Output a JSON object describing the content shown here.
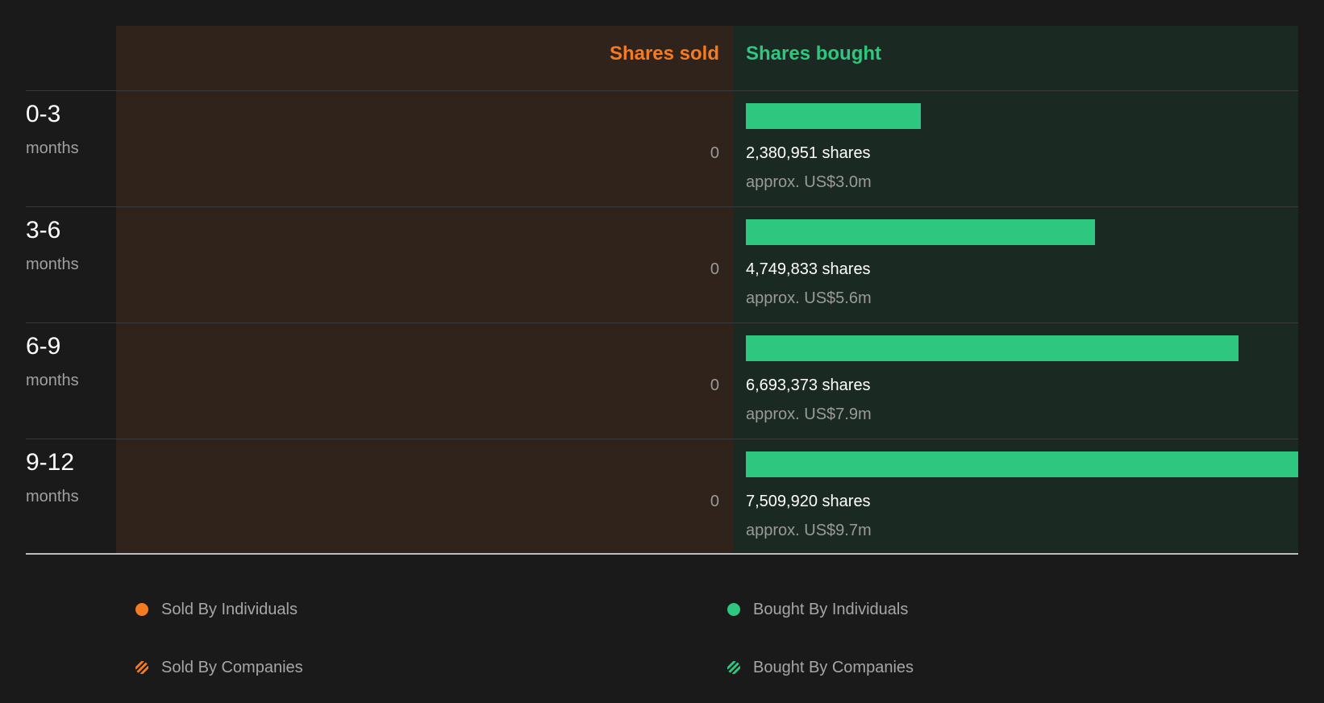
{
  "colors": {
    "sold": "#f47b20",
    "bought": "#2dc77f",
    "sold_panel_bg": "#30231b",
    "bought_panel_bg": "#1b2923",
    "page_bg": "#1a1a1a"
  },
  "chart_data": {
    "type": "bar",
    "title": "",
    "xlabel": "",
    "ylabel": "",
    "headers": {
      "sold": "Shares sold",
      "bought": "Shares bought"
    },
    "categories": [
      "0-3",
      "3-6",
      "6-9",
      "9-12"
    ],
    "unit_label": "months",
    "series": [
      {
        "name": "Shares sold",
        "values": [
          0,
          0,
          0,
          0
        ],
        "labels": [
          "0",
          "0",
          "0",
          "0"
        ]
      },
      {
        "name": "Shares bought",
        "values": [
          2380951,
          4749833,
          6693373,
          7509920
        ],
        "labels": [
          "2,380,951 shares",
          "4,749,833 shares",
          "6,693,373 shares",
          "7,509,920 shares"
        ],
        "approx": [
          "approx. US$3.0m",
          "approx. US$5.6m",
          "approx. US$7.9m",
          "approx. US$9.7m"
        ]
      }
    ],
    "legend": [
      {
        "label": "Sold By Individuals",
        "color": "#f47b20",
        "style": "solid"
      },
      {
        "label": "Sold By Companies",
        "color": "#f47b20",
        "style": "striped"
      },
      {
        "label": "Bought By Individuals",
        "color": "#2dc77f",
        "style": "solid"
      },
      {
        "label": "Bought By Companies",
        "color": "#2dc77f",
        "style": "striped"
      }
    ]
  }
}
